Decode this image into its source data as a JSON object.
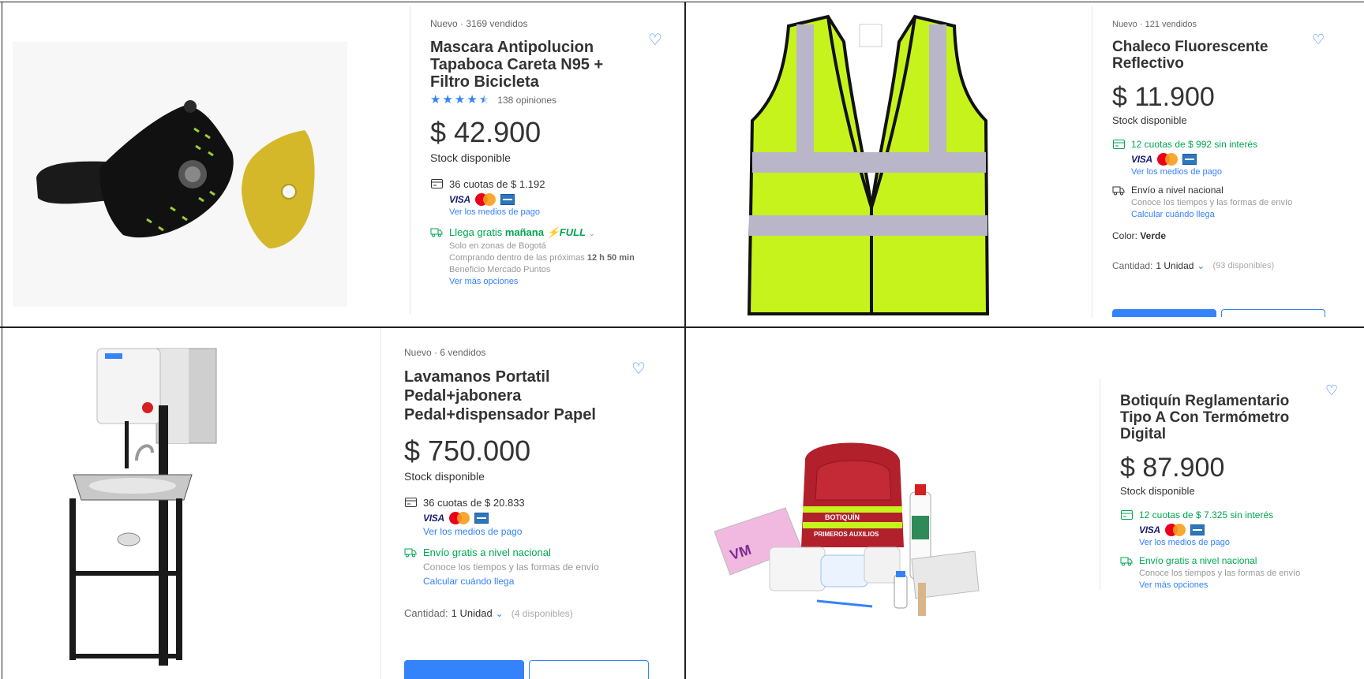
{
  "product1": {
    "condition": "Nuevo",
    "sold": "3169 vendidos",
    "title_l1": "Mascara Antipolucion",
    "title_l2": "Tapaboca Careta N95 +",
    "title_l3": "Filtro Bicicleta",
    "rating": 4.5,
    "reviews": "138 opiniones",
    "price": "$ 42.900",
    "stock": "Stock disponible",
    "installments": "36 cuotas de $ 1.192",
    "payment_link": "Ver los medios de pago",
    "shipping_a": "Llega gratis ",
    "shipping_b": "mañana",
    "shipping_badge": "FULL",
    "zone": "Solo en zonas de Bogotá",
    "within_a": "Comprando dentro de las próximas ",
    "within_b": "12 h 50 min",
    "points": "Beneficio Mercado Puntos",
    "more_link": "Ver más opciones"
  },
  "product2": {
    "condition": "Nuevo",
    "sold": "121 vendidos",
    "title_l1": "Chaleco Fluorescente",
    "title_l2": "Reflectivo",
    "price": "$ 11.900",
    "stock": "Stock disponible",
    "installments": "12 cuotas de $ 992 sin interés",
    "payment_link": "Ver los medios de pago",
    "shipping": "Envío a nivel nacional",
    "shipping_sub": "Conoce los tiempos y las formas de envío",
    "calc_link": "Calcular cuándo llega",
    "color_label": "Color: ",
    "color_value": "Verde",
    "qty_label": "Cantidad: ",
    "qty_value": "1 Unidad",
    "available": "(93 disponibles)"
  },
  "product3": {
    "condition": "Nuevo",
    "sold": "6 vendidos",
    "title_l1": "Lavamanos Portatil",
    "title_l2": "Pedal+jabonera",
    "title_l3": "Pedal+dispensador Papel",
    "price": "$ 750.000",
    "stock": "Stock disponible",
    "installments": "36 cuotas de $ 20.833",
    "payment_link": "Ver los medios de pago",
    "shipping": "Envío gratis a nivel nacional",
    "shipping_sub": "Conoce los tiempos y las formas de envío",
    "calc_link": "Calcular cuándo llega",
    "qty_label": "Cantidad: ",
    "qty_value": "1 Unidad",
    "available": "(4 disponibles)"
  },
  "product4": {
    "title_l1": "Botiquín Reglamentario",
    "title_l2": "Tipo A Con Termómetro",
    "title_l3": "Digital",
    "price": "$ 87.900",
    "stock": "Stock disponible",
    "installments": "12 cuotas de $ 7.325 sin interés",
    "payment_link": "Ver los medios de pago",
    "shipping": "Envío gratis a nivel nacional",
    "shipping_sub": "Conoce los tiempos y las formas de envío",
    "more_link": "Ver más opciones",
    "kit_label_1": "BOTIQUÍN",
    "kit_label_2": "PRIMEROS AUXILIOS"
  },
  "icons": {
    "favorite": "heart-outline-icon",
    "card": "credit-card-icon",
    "truck": "truck-icon",
    "chevron": "chevron-down-icon"
  },
  "colors": {
    "accent": "#3483fa",
    "green": "#00a650",
    "text": "#333333",
    "muted": "#999999"
  }
}
